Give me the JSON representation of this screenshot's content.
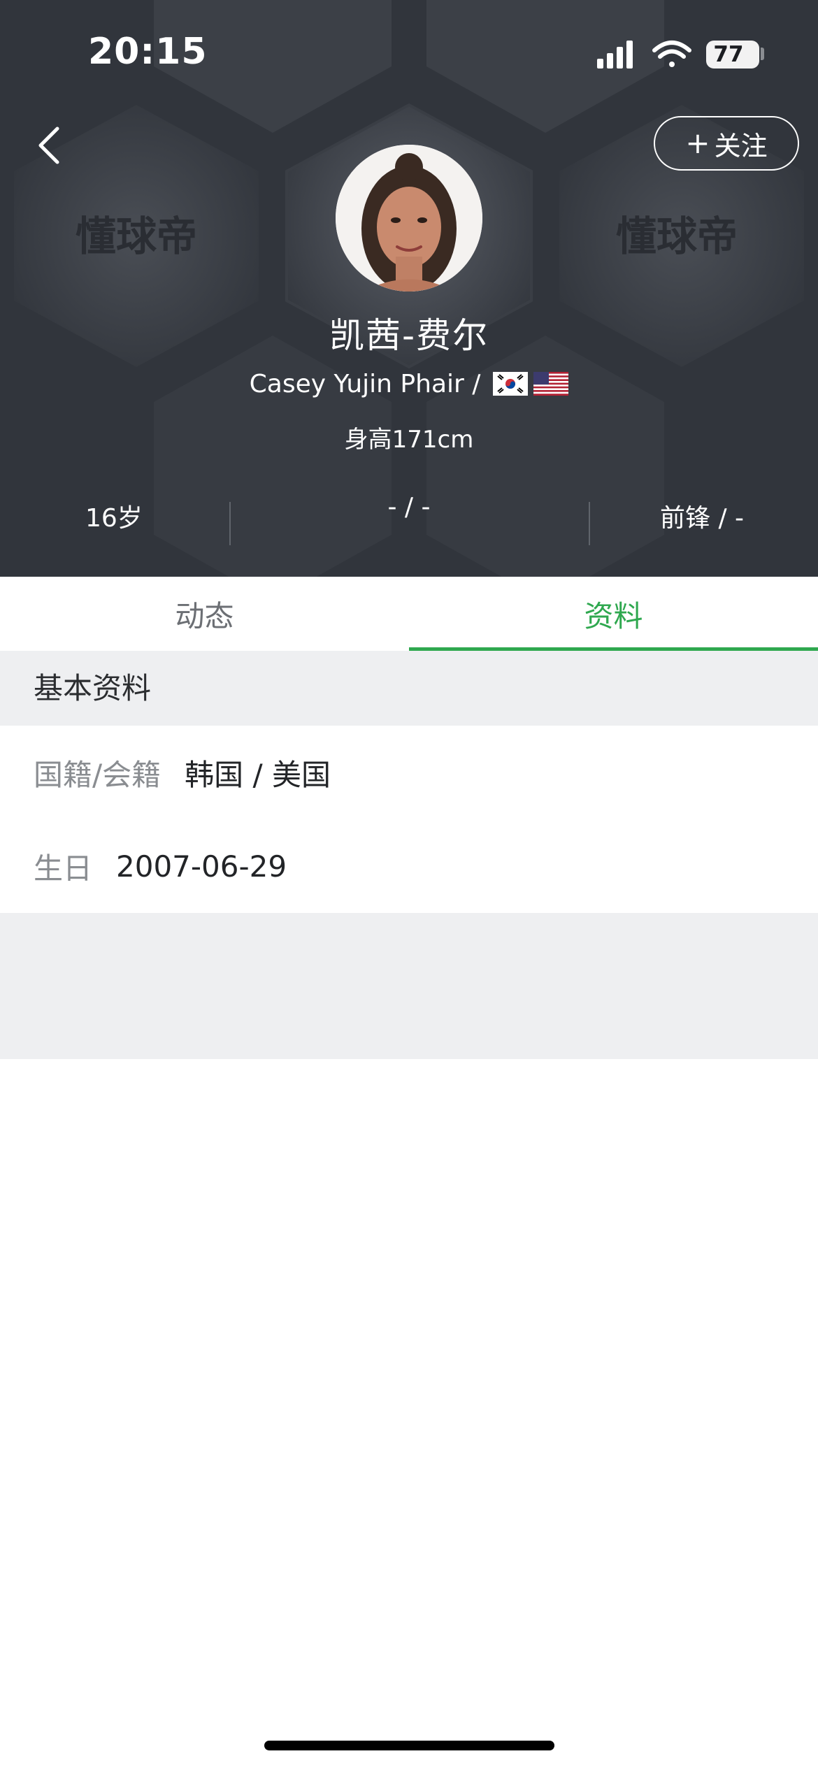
{
  "status_bar": {
    "time": "20:15",
    "battery": "77"
  },
  "header": {
    "back_icon": "chevron-left-icon",
    "follow_label": "关注",
    "follow_icon": "plus-icon",
    "watermark": "懂球帝",
    "name_cn": "凯茜-费尔",
    "name_en": "Casey Yujin Phair /",
    "flags": [
      "south-korea-flag-icon",
      "usa-flag-icon"
    ],
    "height": "身高171cm",
    "stats": {
      "age": "16岁",
      "middle": "- / -",
      "position": "前锋 / -"
    },
    "background_color": "#31353c"
  },
  "tabs": [
    {
      "label": "动态",
      "active": false
    },
    {
      "label": "资料",
      "active": true
    }
  ],
  "accent_color": "#2fa84f",
  "profile": {
    "section_title": "基本资料",
    "rows": [
      {
        "label": "国籍/会籍",
        "value": "韩国 / 美国"
      },
      {
        "label": "生日",
        "value": "2007-06-29"
      }
    ]
  }
}
